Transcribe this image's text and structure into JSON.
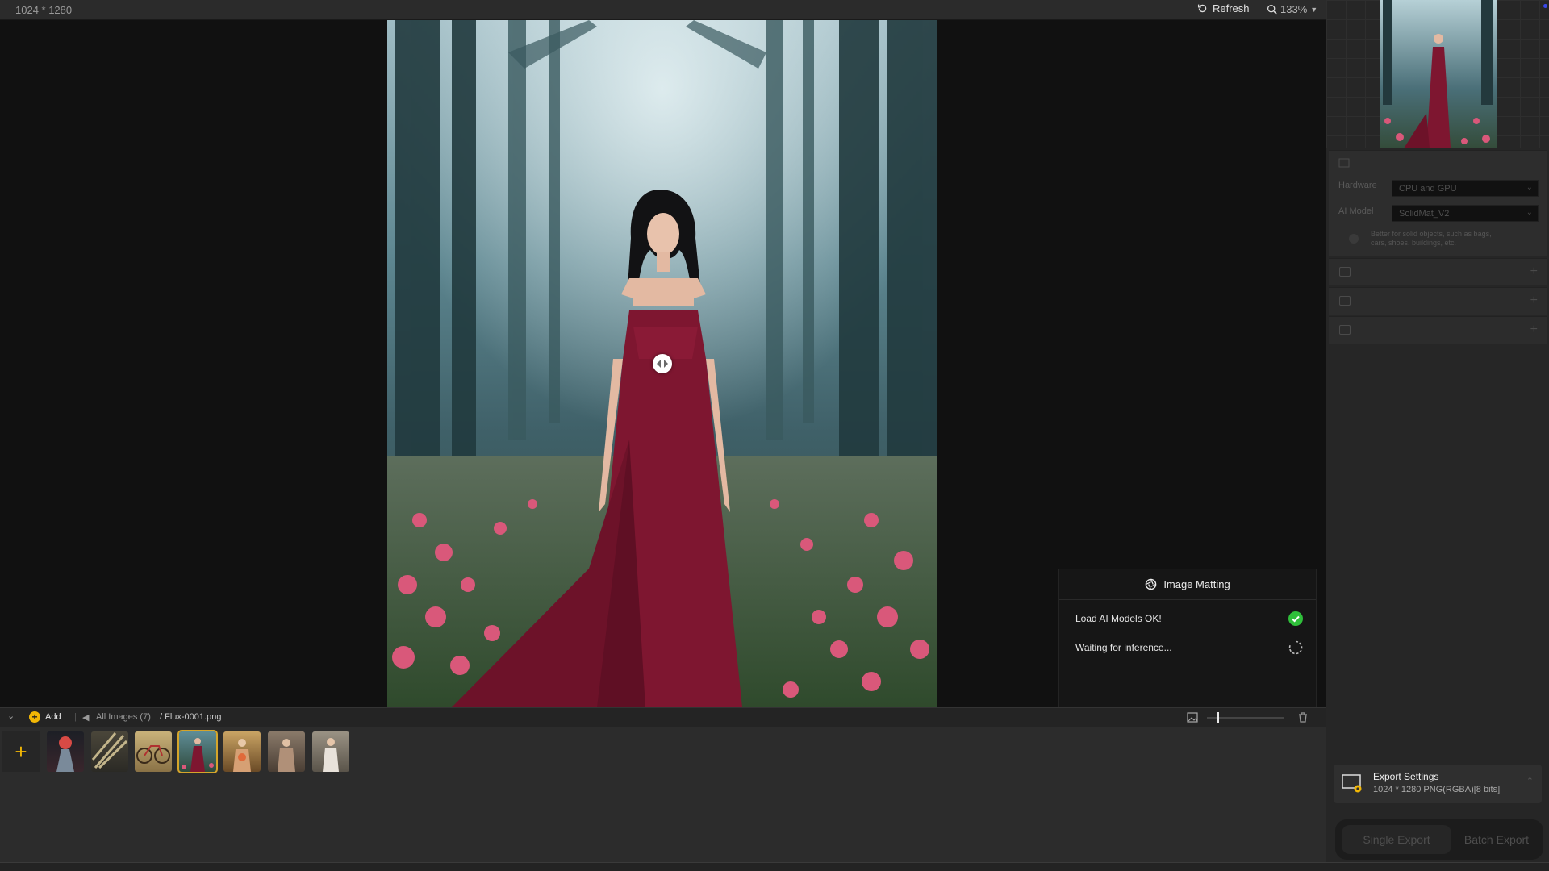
{
  "topbar": {
    "image_dims": "1024 * 1280",
    "refresh_label": "Refresh",
    "zoom_label": "133%"
  },
  "matting": {
    "title": "Image Matting",
    "step1": "Load AI Models OK!",
    "step2": "Waiting for inference..."
  },
  "bottombar": {
    "add_label": "Add",
    "all_images": "All Images (7)",
    "filename": "/ Flux-0001.png"
  },
  "thumbnails": [
    {
      "name": "thumb-1",
      "selected": false
    },
    {
      "name": "thumb-2",
      "selected": false
    },
    {
      "name": "thumb-3",
      "selected": false
    },
    {
      "name": "thumb-4",
      "selected": true
    },
    {
      "name": "thumb-5",
      "selected": false
    },
    {
      "name": "thumb-6",
      "selected": false
    },
    {
      "name": "thumb-7",
      "selected": false
    }
  ],
  "right": {
    "hardware_label": "Hardware",
    "hardware_value": "CPU and GPU",
    "model_label": "AI Model",
    "model_value": "SolidMat_V2",
    "model_hint": "Better for solid objects, such as bags, cars, shoes, buildings, etc."
  },
  "export": {
    "title": "Export Settings",
    "subtitle": "1024 * 1280 PNG(RGBA)[8 bits]",
    "single": "Single Export",
    "batch": "Batch Export"
  },
  "colors": {
    "accent": "#f2b705",
    "split_line": "#b59a2c",
    "success": "#2fbf3a"
  }
}
